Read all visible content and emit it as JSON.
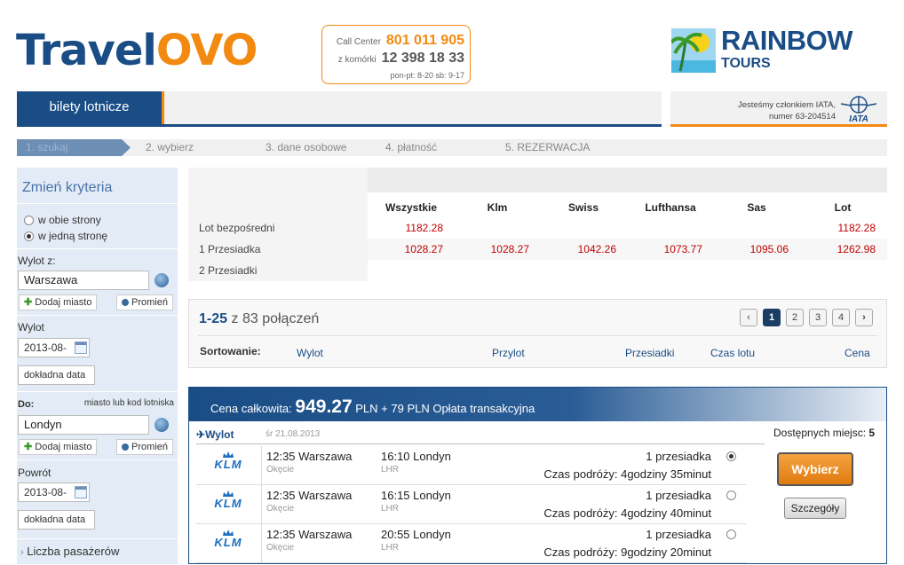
{
  "brand": {
    "part1": "Travel",
    "part2": "OVO"
  },
  "callcenter": {
    "label": "Call Center",
    "number": "801 011 905",
    "mobile_label": "z komórki",
    "mobile_number": "12 398 18 33",
    "hours": "pon-pt: 8-20  sb: 9-17"
  },
  "partner": {
    "line1": "RAINBOW",
    "line2": "TOURS"
  },
  "top_tab": {
    "label": "bilety lotnicze"
  },
  "iata": {
    "line1": "Jesteśmy członkiem IATA,",
    "line2": "numer 63-204514",
    "logo": "IATA"
  },
  "steps": [
    "1. szukaj",
    "2. wybierz",
    "3. dane osobowe",
    "4. płatność",
    "5. REZERWACJA"
  ],
  "sidebar": {
    "title": "Zmień kryteria",
    "trip_round": "w obie strony",
    "trip_oneway": "w jedną stronę",
    "from_label": "Wylot z:",
    "from_value": "Warszawa",
    "add_city": "Dodaj miasto",
    "radius": "Promień",
    "depart_label": "Wylot",
    "depart_date": "2013-08-",
    "exact_date": "dokładna data",
    "to_label": "Do:",
    "to_hint": "miasto lub kod lotniska",
    "to_value": "Londyn",
    "return_label": "Powrót",
    "return_date": "2013-08-",
    "passengers": "Liczba pasażerów"
  },
  "matrix": {
    "airlines": [
      "Wszystkie",
      "Klm",
      "Swiss",
      "Lufthansa",
      "Sas",
      "Lot"
    ],
    "rows": [
      {
        "label": "Lot bezpośredni",
        "prices": [
          "1182.28",
          "",
          "",
          "",
          "",
          "1182.28"
        ]
      },
      {
        "label": "1  Przesiadka",
        "prices": [
          "1028.27",
          "1028.27",
          "1042.26",
          "1073.77",
          "1095.06",
          "1262.98"
        ]
      },
      {
        "label": "2 Przesiadki",
        "prices": [
          "",
          "",
          "",
          "",
          "",
          ""
        ]
      }
    ]
  },
  "results": {
    "range": "1-25",
    "of": "z",
    "total": "83",
    "suffix": "połączeń",
    "pages": [
      "1",
      "2",
      "3",
      "4"
    ],
    "sort_label": "Sortowanie:",
    "sort_options": [
      "Wylot",
      "Przylot",
      "Przesiadki",
      "Czas lotu",
      "Cena"
    ]
  },
  "offer": {
    "total_label": "Cena całkowita:",
    "total_price": "949.27",
    "currency_fee": "PLN + 79 PLN Opłata transakcyjna",
    "direction": "Wylot",
    "date": "śr 21.08.2013",
    "seats_label": "Dostępnych miejsc:",
    "seats": "5",
    "select_label": "Wybierz",
    "details_label": "Szczegóły",
    "flights": [
      {
        "airline": "KLM",
        "dep_time": "12:35 Warszawa",
        "dep_airport": "Okęcie",
        "arr_time": "16:10 Londyn",
        "arr_airport": "LHR",
        "stops": "1 przesiadka",
        "duration": "Czas podróży: 4godziny 35minut",
        "selected": true
      },
      {
        "airline": "KLM",
        "dep_time": "12:35 Warszawa",
        "dep_airport": "Okęcie",
        "arr_time": "16:15 Londyn",
        "arr_airport": "LHR",
        "stops": "1 przesiadka",
        "duration": "Czas podróży: 4godziny 40minut",
        "selected": false
      },
      {
        "airline": "KLM",
        "dep_time": "12:35 Warszawa",
        "dep_airport": "Okęcie",
        "arr_time": "20:55 Londyn",
        "arr_airport": "LHR",
        "stops": "1 przesiadka",
        "duration": "Czas podróży: 9godziny 20minut",
        "selected": false
      }
    ]
  },
  "colors": {
    "brand_blue": "#1a4d86",
    "brand_orange": "#f28a12",
    "price_red": "#c00000"
  }
}
